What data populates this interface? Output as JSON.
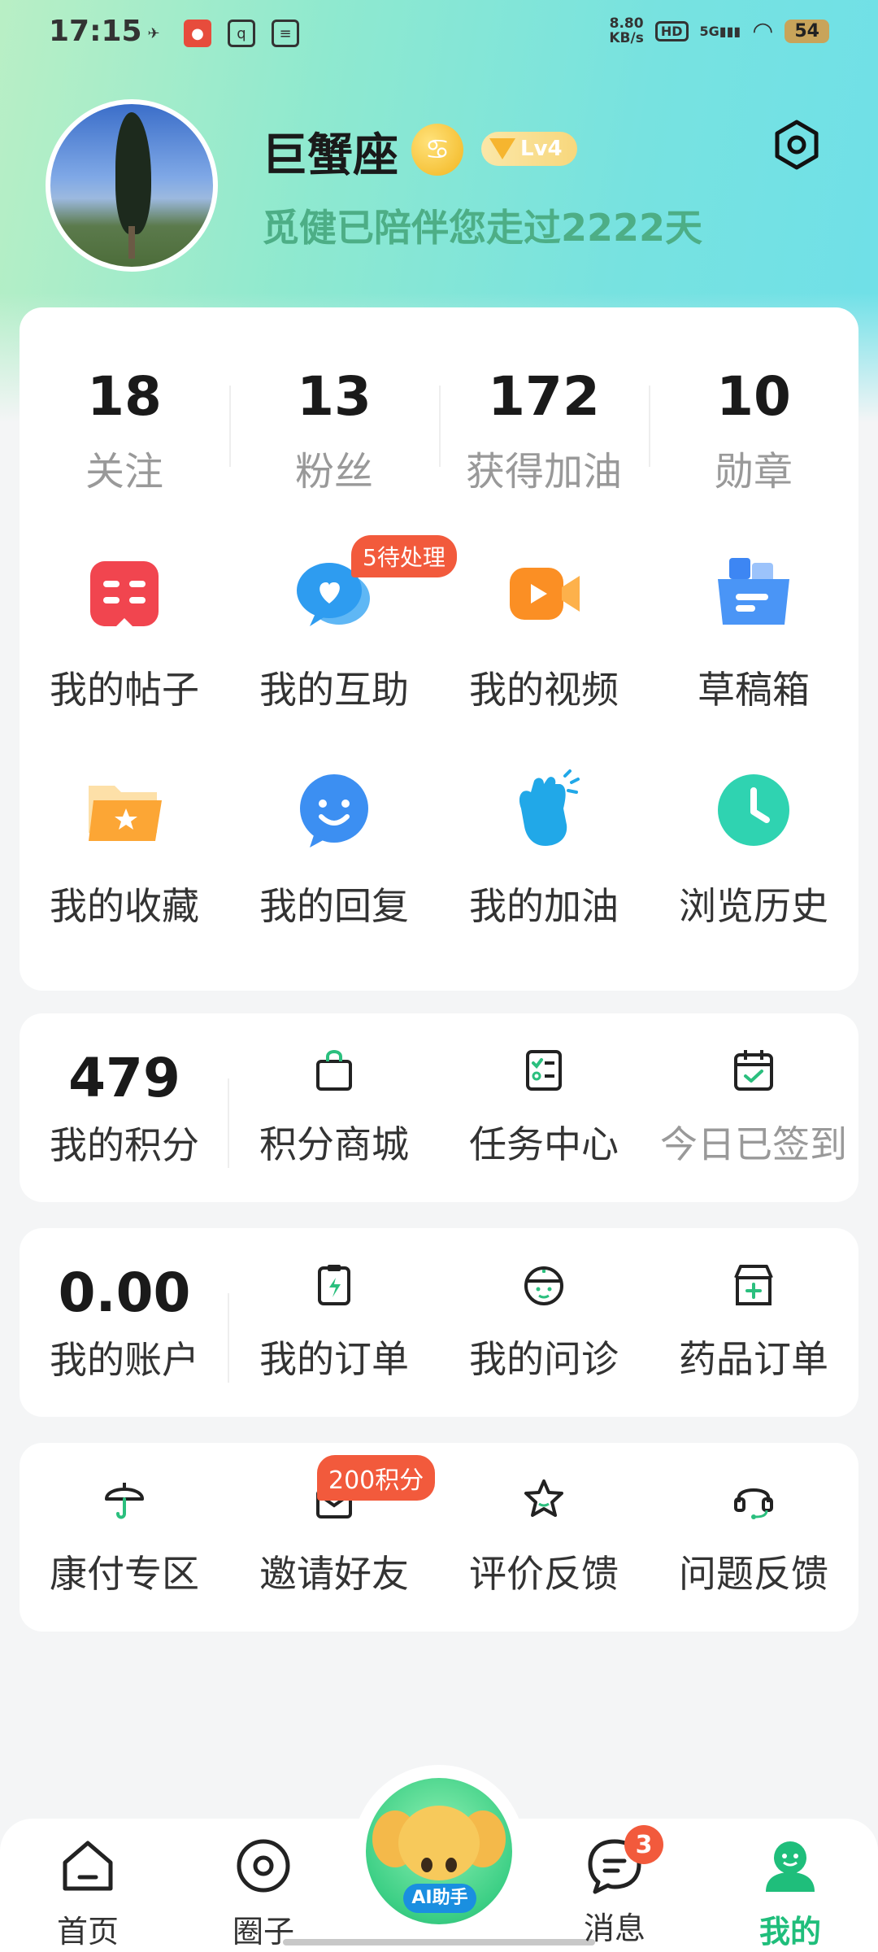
{
  "status_bar": {
    "time": "17:15",
    "net_speed_value": "8.80",
    "net_speed_unit": "KB/s",
    "hd": "HD",
    "signal": "5G",
    "battery": "54"
  },
  "profile": {
    "username": "巨蟹座",
    "zodiac_symbol": "♋",
    "level": "Lv4",
    "days_text": "觅健已陪伴您走过2222天"
  },
  "stats": [
    {
      "value": "18",
      "label": "关注"
    },
    {
      "value": "13",
      "label": "粉丝"
    },
    {
      "value": "172",
      "label": "获得加油"
    },
    {
      "value": "10",
      "label": "勋章"
    }
  ],
  "grid_row1": [
    {
      "label": "我的帖子",
      "icon": "posts-book-icon"
    },
    {
      "label": "我的互助",
      "icon": "chat-heart-icon",
      "badge": "5待处理"
    },
    {
      "label": "我的视频",
      "icon": "video-icon"
    },
    {
      "label": "草稿箱",
      "icon": "drafts-box-icon"
    }
  ],
  "grid_row2": [
    {
      "label": "我的收藏",
      "icon": "favorites-folder-icon"
    },
    {
      "label": "我的回复",
      "icon": "reply-smile-icon"
    },
    {
      "label": "我的加油",
      "icon": "cheer-hand-icon"
    },
    {
      "label": "浏览历史",
      "icon": "history-clock-icon"
    }
  ],
  "points_card": {
    "points_value": "479",
    "points_label": "我的积分",
    "items": [
      {
        "label": "积分商城",
        "icon": "shopping-bag-icon"
      },
      {
        "label": "任务中心",
        "icon": "task-list-icon"
      },
      {
        "label": "今日已签到",
        "icon": "calendar-check-icon"
      }
    ]
  },
  "account_card": {
    "balance_value": "0.00",
    "balance_label": "我的账户",
    "items": [
      {
        "label": "我的订单",
        "icon": "order-clipboard-icon"
      },
      {
        "label": "我的问诊",
        "icon": "doctor-icon"
      },
      {
        "label": "药品订单",
        "icon": "pharmacy-store-icon"
      }
    ]
  },
  "service_card": {
    "items": [
      {
        "label": "康付专区",
        "icon": "umbrella-icon"
      },
      {
        "label": "邀请好友",
        "icon": "invite-envelope-icon",
        "badge": "200积分"
      },
      {
        "label": "评价反馈",
        "icon": "star-icon"
      },
      {
        "label": "问题反馈",
        "icon": "headset-icon"
      }
    ]
  },
  "bottom_nav": {
    "items": [
      {
        "label": "首页",
        "icon": "home-icon"
      },
      {
        "label": "圈子",
        "icon": "circle-icon"
      },
      {
        "label": "消息",
        "icon": "message-icon",
        "badge": "3"
      },
      {
        "label": "我的",
        "icon": "profile-icon"
      }
    ],
    "ai_label": "AI助手"
  },
  "colors": {
    "accent_green": "#1fbe7b",
    "badge_red": "#f25a3c",
    "days_text_green": "#4dae86"
  }
}
